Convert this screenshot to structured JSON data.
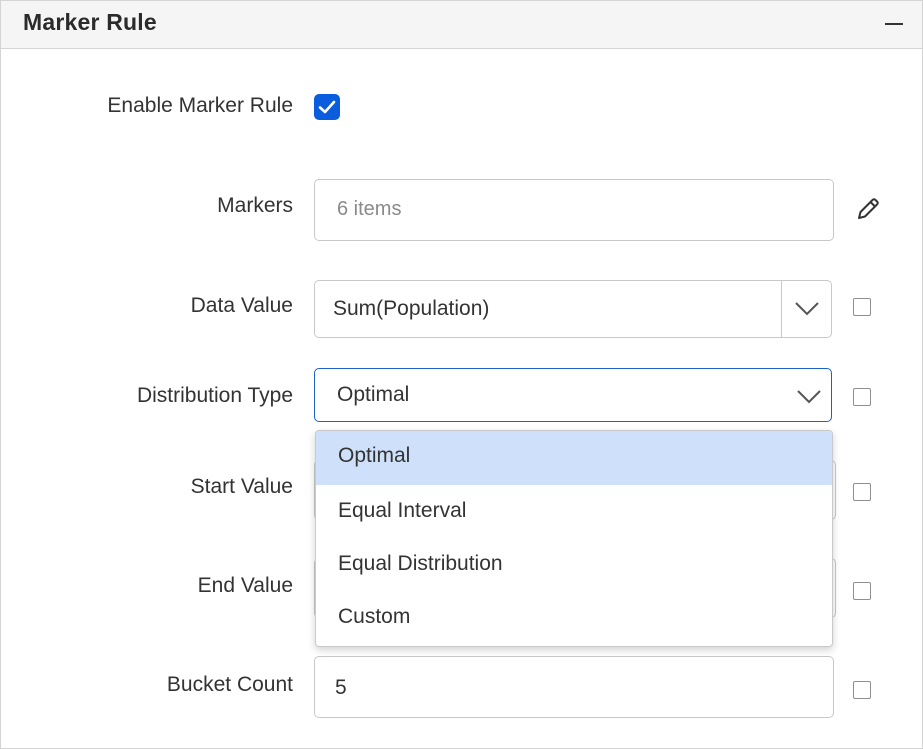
{
  "panel": {
    "title": "Marker Rule"
  },
  "enable": {
    "label": "Enable Marker Rule",
    "checked": true
  },
  "markers": {
    "label": "Markers",
    "placeholder": "6 items"
  },
  "data_value": {
    "label": "Data Value",
    "value": "Sum(Population)"
  },
  "distribution_type": {
    "label": "Distribution Type",
    "value": "Optimal",
    "options": [
      "Optimal",
      "Equal Interval",
      "Equal Distribution",
      "Custom"
    ],
    "selected_index": 0
  },
  "start_value": {
    "label": "Start Value"
  },
  "end_value": {
    "label": "End Value"
  },
  "bucket_count": {
    "label": "Bucket Count",
    "value": "5"
  },
  "colors": {
    "accent": "#0a5ede",
    "selected_option_bg": "#cfe0fb",
    "focus_border": "#1f5fc9"
  },
  "icons": [
    "minus-icon",
    "checkmark-icon",
    "pencil-icon",
    "chevron-down-icon"
  ]
}
